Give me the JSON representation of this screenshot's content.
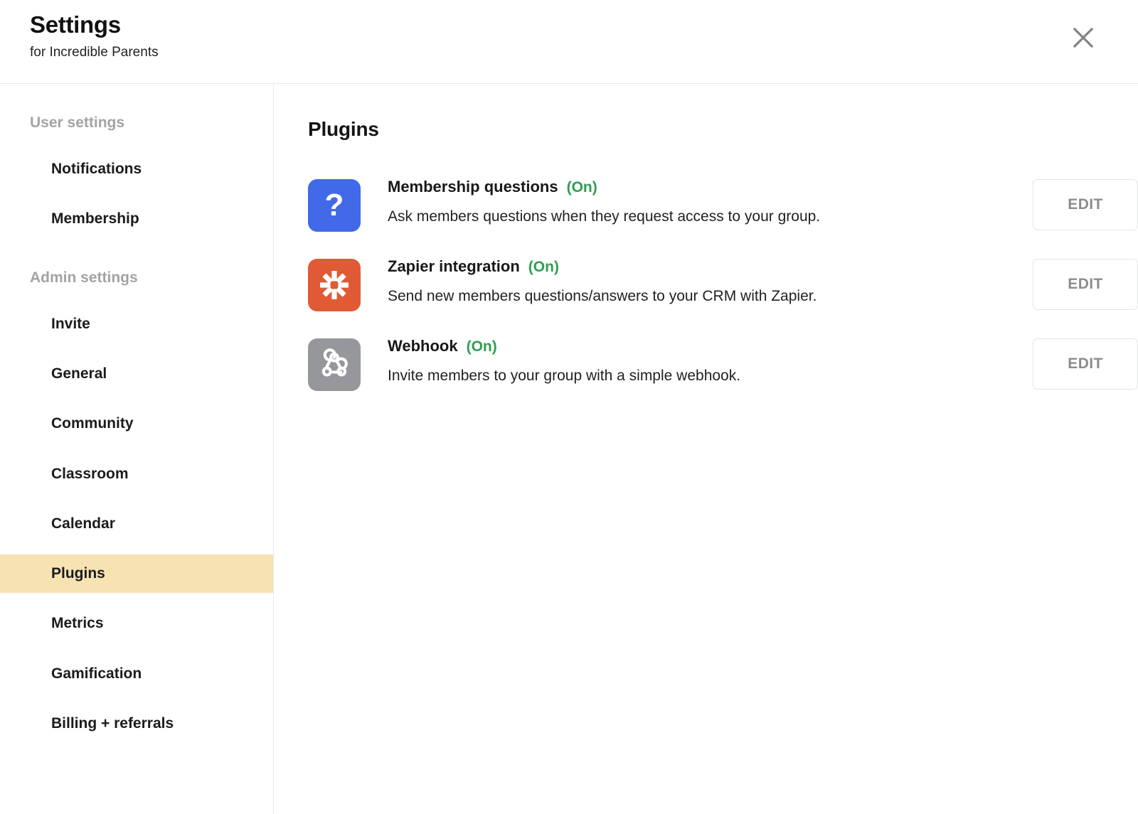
{
  "header": {
    "title": "Settings",
    "subtitle": "for Incredible Parents",
    "close_label": "close-icon"
  },
  "sidebar": {
    "groups": [
      {
        "label": "User settings",
        "items": [
          {
            "label": "Notifications",
            "active": false
          },
          {
            "label": "Membership",
            "active": false
          }
        ]
      },
      {
        "label": "Admin settings",
        "items": [
          {
            "label": "Invite",
            "active": false
          },
          {
            "label": "General",
            "active": false
          },
          {
            "label": "Community",
            "active": false
          },
          {
            "label": "Classroom",
            "active": false
          },
          {
            "label": "Calendar",
            "active": false
          },
          {
            "label": "Plugins",
            "active": true
          },
          {
            "label": "Metrics",
            "active": false
          },
          {
            "label": "Gamification",
            "active": false
          },
          {
            "label": "Billing + referrals",
            "active": false
          }
        ]
      }
    ],
    "active_item": "Plugins",
    "active_highlight_color": "#f7e2b2",
    "group_label_color": "#a3a3a6"
  },
  "main": {
    "title": "Plugins",
    "edit_label": "EDIT",
    "state_color": "#2f9e4f",
    "plugins": [
      {
        "name": "Membership questions",
        "state": "(On)",
        "description": "Ask members questions when they request access to your group.",
        "icon": "question-mark-icon",
        "icon_color": "#4169e8",
        "action": "EDIT"
      },
      {
        "name": "Zapier integration",
        "state": "(On)",
        "description": "Send new members questions/answers to your CRM with Zapier.",
        "icon": "zapier-asterisk-icon",
        "icon_color": "#e05a35",
        "action": "EDIT"
      },
      {
        "name": "Webhook",
        "state": "(On)",
        "description": "Invite members to your group with a simple webhook.",
        "icon": "webhook-icon",
        "icon_color": "#96979a",
        "action": "EDIT"
      }
    ]
  }
}
